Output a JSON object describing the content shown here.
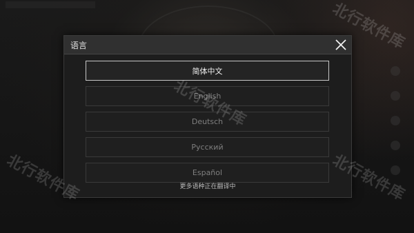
{
  "dialog": {
    "title": "语言",
    "close_icon": "close-icon",
    "options": [
      {
        "label": "简体中文",
        "selected": true
      },
      {
        "label": "English",
        "selected": false
      },
      {
        "label": "Deutsch",
        "selected": false
      },
      {
        "label": "Русский",
        "selected": false
      },
      {
        "label": "Español",
        "selected": false
      }
    ],
    "more_note": "更多语种正在翻译中"
  },
  "watermark": {
    "text": "北行软件库"
  },
  "colors": {
    "header_bg": "#303030",
    "dialog_bg": "#1d1d1d",
    "selected_border": "#c9c9c9",
    "option_border": "#3a3a3a"
  }
}
